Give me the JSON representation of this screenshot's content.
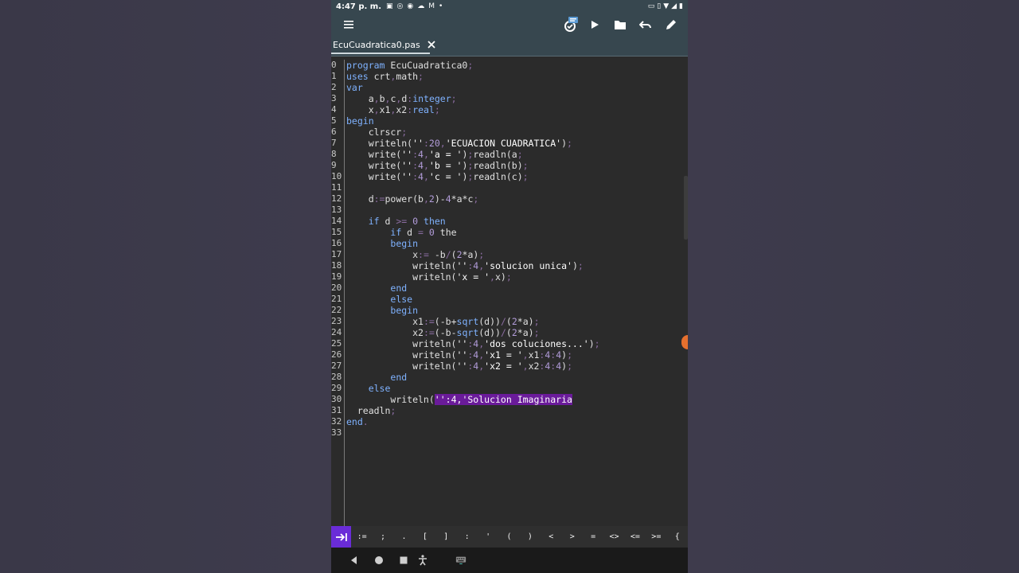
{
  "status_bar": {
    "time": "4:47 p. m.",
    "left_icons": [
      "image-icon",
      "whatsapp-icon",
      "messenger-icon",
      "cloud-icon",
      "gmail-icon",
      "dot-icon"
    ],
    "right_icons": [
      "cast-icon",
      "vibrate-icon",
      "wifi-icon",
      "signal-icon",
      "battery-icon"
    ]
  },
  "toolbar": {
    "icons": [
      "menu-icon",
      "compile-icon",
      "run-icon",
      "folder-icon",
      "undo-icon",
      "edit-icon"
    ]
  },
  "tab": {
    "filename": "EcuCuadratica0.pas"
  },
  "editor": {
    "line_numbers": [
      "0",
      "1",
      "2",
      "3",
      "4",
      "5",
      "6",
      "7",
      "8",
      "9",
      "10",
      "11",
      "12",
      "13",
      "14",
      "15",
      "16",
      "17",
      "18",
      "19",
      "20",
      "21",
      "22",
      "23",
      "24",
      "25",
      "26",
      "27",
      "28",
      "29",
      "30",
      "31",
      "32",
      "33"
    ]
  },
  "symbol_bar": {
    "tab_key_icon": "tab-arrow-icon",
    "symbols": [
      ":=",
      ";",
      ".",
      "[",
      "]",
      ":",
      "'",
      "(",
      ")",
      "<",
      ">",
      "=",
      "<>",
      "<=",
      ">=",
      "{"
    ]
  },
  "nav_bar": {
    "icons": [
      "back-icon",
      "home-icon",
      "recents-icon",
      "accessibility-icon",
      "keyboard-icon"
    ]
  },
  "colors": {
    "keyword": "#7fb2ff",
    "number": "#b39ddb",
    "punctuation": "#8a6ca0",
    "selection": "#6a1b9a",
    "tab_key": "#6a2cd8",
    "toolbar": "#37474f"
  }
}
